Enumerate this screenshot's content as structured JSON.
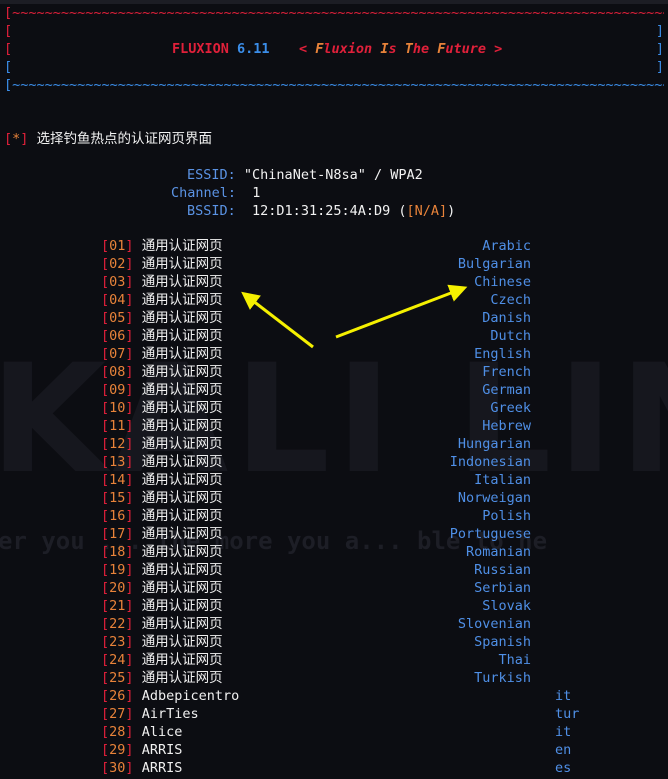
{
  "banner": {
    "app_name": "FLUXION",
    "version": "6.11",
    "tagline_parts": [
      "< ",
      "F",
      "luxion ",
      "I",
      "s ",
      "T",
      "he ",
      "F",
      "uture",
      " >"
    ]
  },
  "watermark": {
    "logo": "KALI LINUX",
    "slogan": "er you ... the more you a... ble to he"
  },
  "prompt": {
    "marker": "*",
    "text": "选择钓鱼热点的认证网页界面"
  },
  "network": {
    "essid_label": "ESSID:",
    "essid_value": "\"ChinaNet-N8sa\" / WPA2",
    "channel_label": "Channel:",
    "channel_value": "1",
    "bssid_label": "BSSID:",
    "bssid_value": "12:D1:31:25:4A:D9",
    "bssid_vendor": "N/A"
  },
  "portal_name": "通用认证网页",
  "generic_portals": [
    {
      "num": "01",
      "lang": "Arabic"
    },
    {
      "num": "02",
      "lang": "Bulgarian"
    },
    {
      "num": "03",
      "lang": "Chinese"
    },
    {
      "num": "04",
      "lang": "Czech"
    },
    {
      "num": "05",
      "lang": "Danish"
    },
    {
      "num": "06",
      "lang": "Dutch"
    },
    {
      "num": "07",
      "lang": "English"
    },
    {
      "num": "08",
      "lang": "French"
    },
    {
      "num": "09",
      "lang": "German"
    },
    {
      "num": "10",
      "lang": "Greek"
    },
    {
      "num": "11",
      "lang": "Hebrew"
    },
    {
      "num": "12",
      "lang": "Hungarian"
    },
    {
      "num": "13",
      "lang": "Indonesian"
    },
    {
      "num": "14",
      "lang": "Italian"
    },
    {
      "num": "15",
      "lang": "Norweigan"
    },
    {
      "num": "16",
      "lang": "Polish"
    },
    {
      "num": "17",
      "lang": "Portuguese"
    },
    {
      "num": "18",
      "lang": "Romanian"
    },
    {
      "num": "19",
      "lang": "Russian"
    },
    {
      "num": "20",
      "lang": "Serbian"
    },
    {
      "num": "21",
      "lang": "Slovak"
    },
    {
      "num": "22",
      "lang": "Slovenian"
    },
    {
      "num": "23",
      "lang": "Spanish"
    },
    {
      "num": "24",
      "lang": "Thai"
    },
    {
      "num": "25",
      "lang": "Turkish"
    }
  ],
  "vendor_portals": [
    {
      "num": "26",
      "name": "Adbepicentro",
      "code": "it"
    },
    {
      "num": "27",
      "name": "AirTies",
      "code": "tur"
    },
    {
      "num": "28",
      "name": "Alice",
      "code": "it"
    },
    {
      "num": "29",
      "name": "ARRIS",
      "code": "en"
    },
    {
      "num": "30",
      "name": "ARRIS",
      "code": "es"
    }
  ],
  "colors": {
    "background": "#0c0d12",
    "red": "#e0203a",
    "blue": "#3b8eea",
    "orange": "#e8833a",
    "arrow": "#f5f000"
  }
}
